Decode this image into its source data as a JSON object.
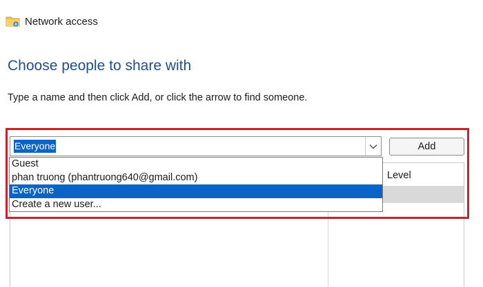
{
  "window": {
    "title": "Network access",
    "icon": "folder-network-icon"
  },
  "heading": "Choose people to share with",
  "instruction": "Type a name and then click Add, or click the arrow to find someone.",
  "combo": {
    "value": "Everyone",
    "arrow_icon": "chevron-down-icon"
  },
  "add_button": {
    "label": "Add"
  },
  "dropdown": {
    "items": [
      {
        "label": "Guest"
      },
      {
        "label": "phan truong (phantruong640@gmail.com)"
      },
      {
        "label": "Everyone",
        "selected": true
      },
      {
        "label": "Create a new user..."
      }
    ]
  },
  "table": {
    "level_header": "Level"
  },
  "colors": {
    "heading_blue": "#1f4e8c",
    "selection_blue": "#0a64c8",
    "highlight_red": "#cc1f2b"
  }
}
